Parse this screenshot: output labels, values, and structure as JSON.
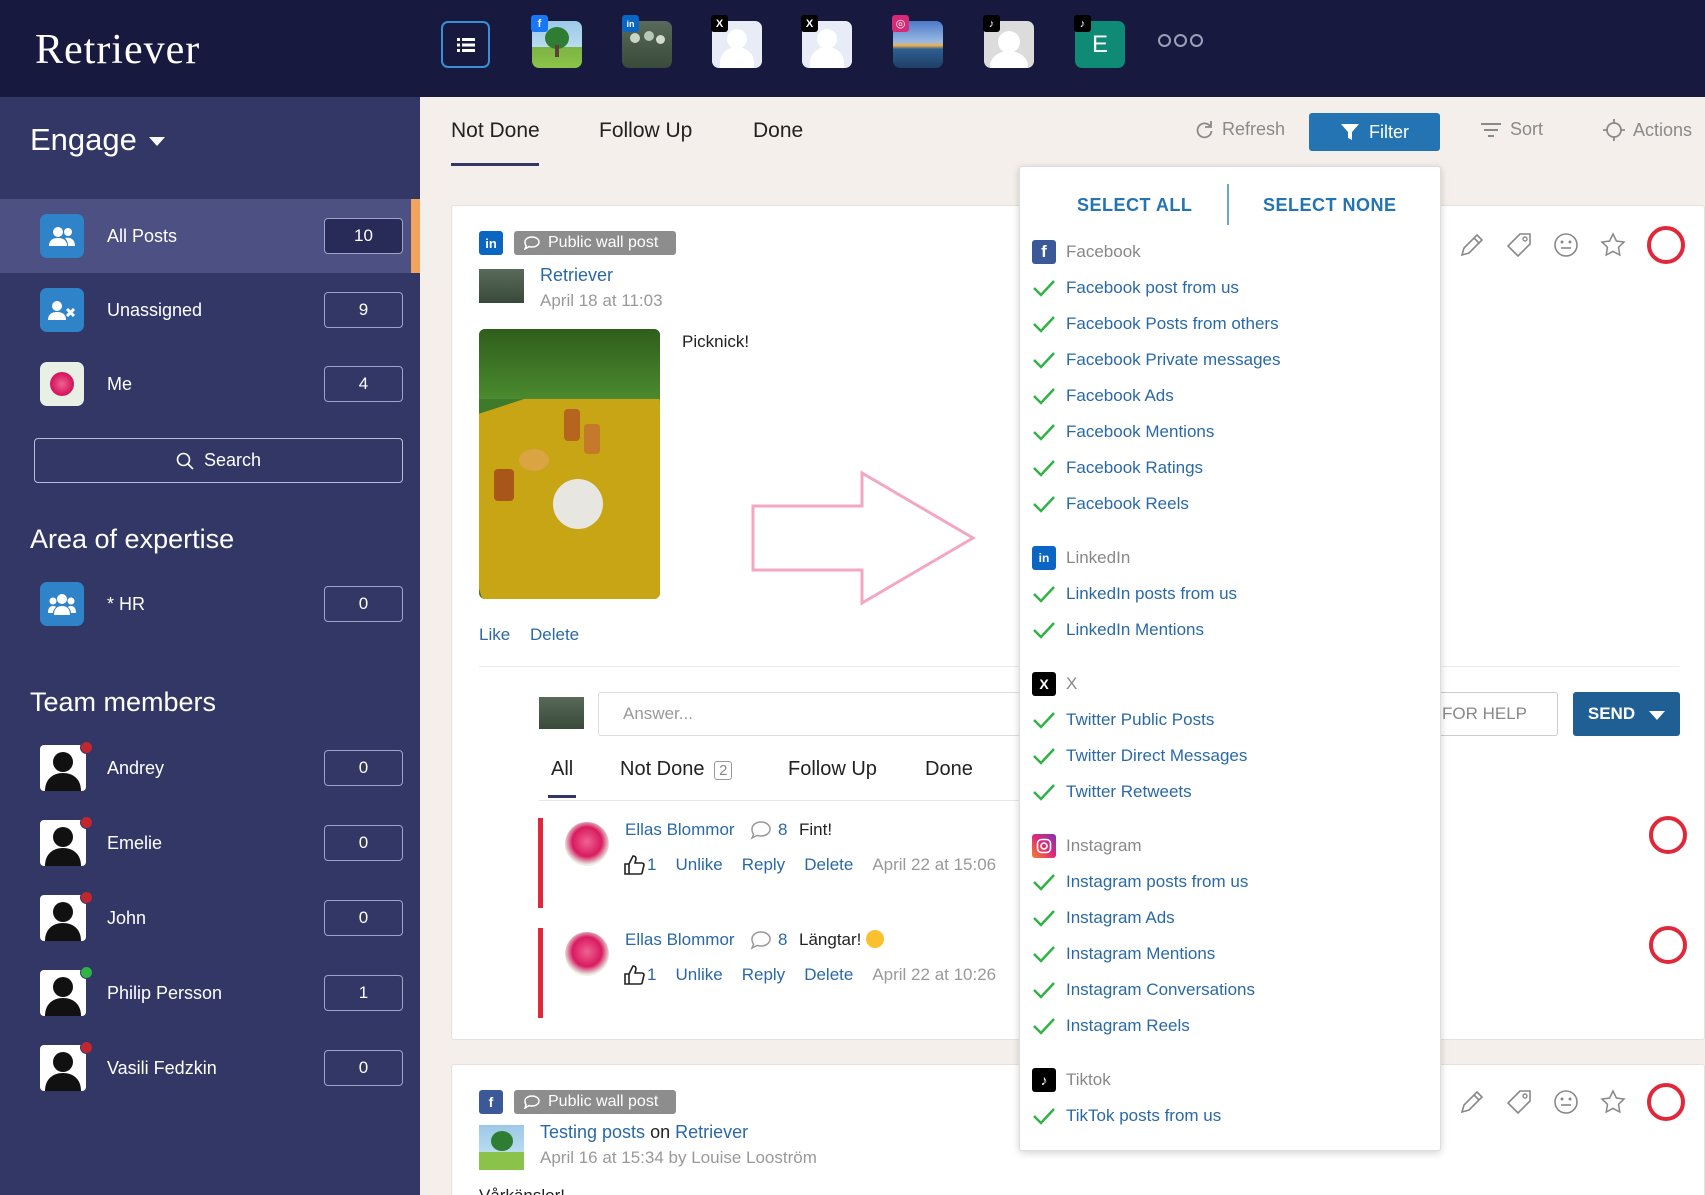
{
  "app": {
    "logo": "Retriever"
  },
  "accounts": [
    {
      "network": "facebook",
      "badge": "f"
    },
    {
      "network": "linkedin",
      "badge": "in"
    },
    {
      "network": "x",
      "badge": "X"
    },
    {
      "network": "x",
      "badge": "X"
    },
    {
      "network": "instagram",
      "badge": "◎"
    },
    {
      "network": "tiktok",
      "badge": "♪"
    },
    {
      "network": "tiktok",
      "badge": "♪",
      "letter": "E"
    }
  ],
  "sidebar": {
    "section": "Engage",
    "items": [
      {
        "label": "All Posts",
        "count": "10"
      },
      {
        "label": "Unassigned",
        "count": "9"
      },
      {
        "label": "Me",
        "count": "4"
      }
    ],
    "search_label": "Search",
    "expertise_heading": "Area of expertise",
    "expertise": [
      {
        "label": "* HR",
        "count": "0"
      }
    ],
    "team_heading": "Team members",
    "team": [
      {
        "name": "Andrey",
        "count": "0",
        "status": "#c1272d"
      },
      {
        "name": "Emelie",
        "count": "0",
        "status": "#c1272d"
      },
      {
        "name": "John",
        "count": "0",
        "status": "#c1272d"
      },
      {
        "name": "Philip Persson",
        "count": "1",
        "status": "#2fb344"
      },
      {
        "name": "Vasili Fedzkin",
        "count": "0",
        "status": "#c1272d"
      }
    ]
  },
  "tabs": [
    "Not Done",
    "Follow Up",
    "Done"
  ],
  "toolbar": {
    "refresh": "Refresh",
    "filter": "Filter",
    "sort": "Sort",
    "actions": "Actions"
  },
  "post1": {
    "tag": "Public wall post",
    "author": "Retriever",
    "date": "April 18 at 11:03",
    "text": "Picknick!",
    "like": "Like",
    "delete": "Delete",
    "answer_placeholder": "Answer...",
    "help": "FOR HELP",
    "send": "SEND",
    "subtabs": {
      "all": "All",
      "not_done": "Not Done",
      "not_done_count": "2",
      "follow_up": "Follow Up",
      "done": "Done"
    },
    "comments": [
      {
        "author": "Ellas Blommor",
        "replies": "8",
        "text": "Fint!",
        "likes": "1",
        "unlike": "Unlike",
        "reply": "Reply",
        "delete": "Delete",
        "date": "April 22 at 15:06"
      },
      {
        "author": "Ellas Blommor",
        "replies": "8",
        "text": "Längtar!",
        "likes": "1",
        "unlike": "Unlike",
        "reply": "Reply",
        "delete": "Delete",
        "date": "April 22 at 10:26"
      }
    ]
  },
  "post2": {
    "tag": "Public wall post",
    "author": "Testing posts",
    "on": "on",
    "page": "Retriever",
    "date": "April 16 at 15:34 by Louise Looström",
    "text": "Vårkänslor!"
  },
  "filter": {
    "select_all": "SELECT ALL",
    "select_none": "SELECT NONE",
    "groups": [
      {
        "name": "Facebook",
        "color": "#3b5998",
        "options": [
          "Facebook post from us",
          "Facebook Posts from others",
          "Facebook Private messages",
          "Facebook Ads",
          "Facebook Mentions",
          "Facebook Ratings",
          "Facebook Reels"
        ]
      },
      {
        "name": "LinkedIn",
        "color": "#0a66c2",
        "options": [
          "LinkedIn posts from us",
          "LinkedIn Mentions"
        ]
      },
      {
        "name": "X",
        "color": "#000000",
        "options": [
          "Twitter Public Posts",
          "Twitter Direct Messages",
          "Twitter Retweets"
        ]
      },
      {
        "name": "Instagram",
        "color": "#d62976",
        "options": [
          "Instagram posts from us",
          "Instagram Ads",
          "Instagram Mentions",
          "Instagram Conversations",
          "Instagram Reels"
        ]
      },
      {
        "name": "Tiktok",
        "color": "#000000",
        "options": [
          "TikTok posts from us"
        ]
      }
    ]
  },
  "colors": {
    "accent": "#2473b2",
    "sidebar": "#333766",
    "topbar": "#17193f",
    "alert": "#e0283a",
    "check": "#2fb344"
  }
}
